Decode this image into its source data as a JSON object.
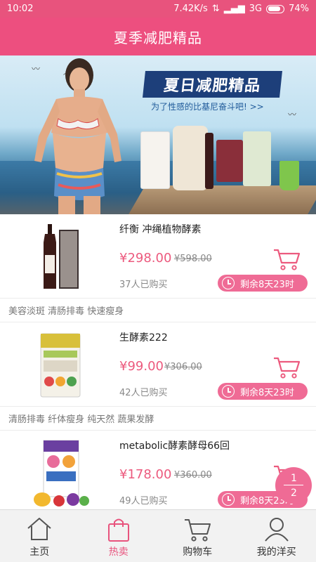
{
  "status_bar": {
    "time": "10:02",
    "network_speed": "7.42K/s",
    "network_type": "3G",
    "battery": "74%"
  },
  "header": {
    "title": "夏季减肥精品"
  },
  "banner": {
    "headline": "夏日减肥精品",
    "subline": "为了性感的比基尼奋斗吧! >>"
  },
  "products": [
    {
      "name": "纤衡 冲绳植物酵素",
      "price": "¥298.00",
      "original_price": "¥598.00",
      "buyers": "37人已购买",
      "countdown": "剩余8天23时"
    },
    {
      "name": "生酵素222",
      "price": "¥99.00",
      "original_price": "¥306.00",
      "buyers": "42人已购买",
      "countdown": "剩余8天23时"
    },
    {
      "name": "metabolic酵素酵母66回",
      "price": "¥178.00",
      "original_price": "¥360.00",
      "buyers": "49人已购买",
      "countdown": "剩余8天23时"
    }
  ],
  "taglines": [
    "美容淡斑 清肠排毒 快速瘦身",
    "清肠排毒 纤体瘦身 纯天然 蔬果发酵"
  ],
  "page_indicator": {
    "current": "1",
    "total": "2"
  },
  "tabs": [
    {
      "label": "主页",
      "icon": "home-icon",
      "active": false
    },
    {
      "label": "热卖",
      "icon": "shopping-bag-icon",
      "active": true
    },
    {
      "label": "购物车",
      "icon": "cart-icon",
      "active": false
    },
    {
      "label": "我的洋买",
      "icon": "user-icon",
      "active": false
    }
  ],
  "colors": {
    "brand": "#ED4F7F",
    "accent": "#EF6B95",
    "price": "#EC5A7E"
  }
}
